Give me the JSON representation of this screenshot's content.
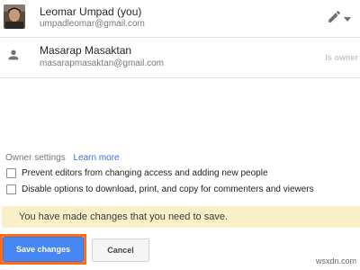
{
  "users": [
    {
      "name": "Leomar Umpad (you)",
      "email": "umpadleomar@gmail.com",
      "avatar": "photo-avatar",
      "permission_icon": "pencil-icon"
    },
    {
      "name": "Masarap Masaktan",
      "email": "masarapmasaktan@gmail.com",
      "avatar": "person-icon",
      "permission_label": "Is owner"
    }
  ],
  "owner_settings": {
    "label": "Owner settings",
    "learn_more": "Learn more",
    "options": [
      {
        "label": "Prevent editors from changing access and adding new people",
        "checked": false
      },
      {
        "label": "Disable options to download, print, and copy for commenters and viewers",
        "checked": false
      }
    ]
  },
  "notice": {
    "text": "You have made changes that you need to save.",
    "background": "#faf0c7"
  },
  "buttons": {
    "save": "Save changes",
    "cancel": "Cancel",
    "save_color": "#4787f3",
    "highlight_color": "#ff6a13"
  },
  "watermark": "wsxdn.com"
}
